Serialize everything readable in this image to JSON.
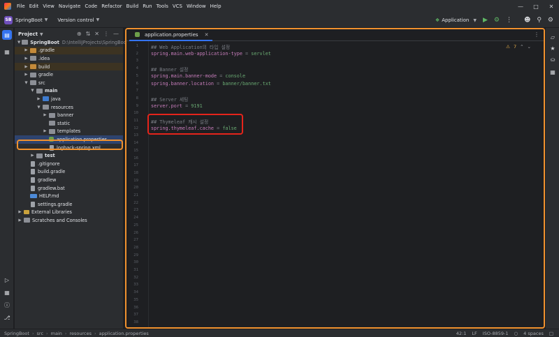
{
  "menubar": {
    "items": [
      "File",
      "Edit",
      "View",
      "Navigate",
      "Code",
      "Refactor",
      "Build",
      "Run",
      "Tools",
      "VCS",
      "Window",
      "Help"
    ]
  },
  "toolbar": {
    "project_badge": "SB",
    "project_name": "SpringBoot",
    "vcs_label": "Version control",
    "run_config": "Application"
  },
  "project_panel": {
    "title": "Project",
    "tree": [
      {
        "label": "SpringBoot",
        "extra": "D:\\IntelliJProjects\\SpringBoot",
        "depth": 0,
        "expanded": true,
        "icon": "folder",
        "style": "bold"
      },
      {
        "label": ".gradle",
        "depth": 1,
        "expanded": false,
        "icon": "folder-o",
        "style": "excluded"
      },
      {
        "label": ".idea",
        "depth": 1,
        "expanded": false,
        "icon": "folder",
        "style": ""
      },
      {
        "label": "build",
        "depth": 1,
        "expanded": false,
        "icon": "folder-o",
        "style": "excluded"
      },
      {
        "label": "gradle",
        "depth": 1,
        "expanded": false,
        "icon": "folder",
        "style": ""
      },
      {
        "label": "src",
        "depth": 1,
        "expanded": true,
        "icon": "folder",
        "style": ""
      },
      {
        "label": "main",
        "depth": 2,
        "expanded": true,
        "icon": "folder",
        "style": "bold"
      },
      {
        "label": "java",
        "depth": 3,
        "expanded": false,
        "icon": "folder-b",
        "style": ""
      },
      {
        "label": "resources",
        "depth": 3,
        "expanded": true,
        "icon": "folder",
        "style": ""
      },
      {
        "label": "banner",
        "depth": 4,
        "expanded": false,
        "icon": "folder",
        "style": ""
      },
      {
        "label": "static",
        "depth": 4,
        "leaf": true,
        "icon": "folder",
        "style": ""
      },
      {
        "label": "templates",
        "depth": 4,
        "expanded": false,
        "icon": "folder",
        "style": ""
      },
      {
        "label": "application.properties",
        "depth": 4,
        "leaf": true,
        "icon": "prop",
        "style": "selected"
      },
      {
        "label": "logback-spring.xml",
        "depth": 4,
        "leaf": true,
        "icon": "file",
        "style": ""
      },
      {
        "label": "test",
        "depth": 2,
        "expanded": false,
        "icon": "folder",
        "style": "bold"
      },
      {
        "label": ".gitignore",
        "depth": 1,
        "leaf": true,
        "icon": "file",
        "style": ""
      },
      {
        "label": "build.gradle",
        "depth": 1,
        "leaf": true,
        "icon": "file",
        "style": ""
      },
      {
        "label": "gradlew",
        "depth": 1,
        "leaf": true,
        "icon": "file",
        "style": ""
      },
      {
        "label": "gradlew.bat",
        "depth": 1,
        "leaf": true,
        "icon": "file",
        "style": ""
      },
      {
        "label": "HELP.md",
        "depth": 1,
        "leaf": true,
        "icon": "md",
        "style": ""
      },
      {
        "label": "settings.gradle",
        "depth": 1,
        "leaf": true,
        "icon": "file",
        "style": ""
      },
      {
        "label": "External Libraries",
        "depth": 0,
        "expanded": false,
        "icon": "lib",
        "style": ""
      },
      {
        "label": "Scratches and Consoles",
        "depth": 0,
        "expanded": false,
        "icon": "folder",
        "style": ""
      }
    ]
  },
  "editor": {
    "tab_label": "application.properties",
    "warnings": "7",
    "line_count": 38,
    "lines": [
      [
        {
          "t": "## Web Application의 타입 설정",
          "c": "cmt"
        }
      ],
      [
        {
          "t": "spring.main.web-application-type",
          "c": "key"
        },
        {
          "t": " = ",
          "c": "cmt"
        },
        {
          "t": "servlet",
          "c": "val"
        }
      ],
      [],
      [
        {
          "t": "## Banner 설정",
          "c": "cmt"
        }
      ],
      [
        {
          "t": "spring.main.banner-mode",
          "c": "key"
        },
        {
          "t": " = ",
          "c": "cmt"
        },
        {
          "t": "console",
          "c": "val"
        }
      ],
      [
        {
          "t": "spring.banner.location",
          "c": "key"
        },
        {
          "t": " = ",
          "c": "cmt"
        },
        {
          "t": "banner/banner.txt",
          "c": "val"
        }
      ],
      [],
      [
        {
          "t": "## Server 세팅",
          "c": "cmt"
        }
      ],
      [
        {
          "t": "server.port",
          "c": "key"
        },
        {
          "t": " = ",
          "c": "cmt"
        },
        {
          "t": "9191",
          "c": "val"
        }
      ],
      [],
      [
        {
          "t": "## Thymeleaf 캐시 설정",
          "c": "cmt"
        }
      ],
      [
        {
          "t": "spring.thymeleaf.cache",
          "c": "key"
        },
        {
          "t": " = ",
          "c": "cmt"
        },
        {
          "t": "false",
          "c": "val"
        }
      ]
    ]
  },
  "statusbar": {
    "breadcrumb": [
      "SpringBoot",
      "src",
      "main",
      "resources",
      "application.properties"
    ],
    "position": "42:1",
    "line_sep": "LF",
    "encoding": "ISO-8859-1",
    "indent": "4 spaces"
  }
}
